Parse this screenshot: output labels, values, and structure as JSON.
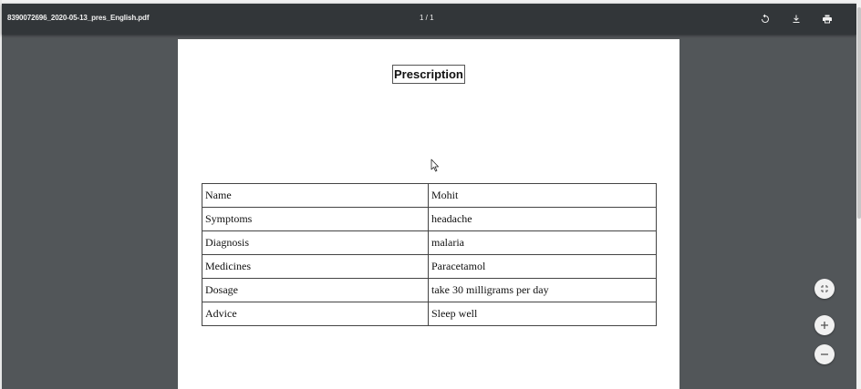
{
  "toolbar": {
    "document_title": "8390072696_2020-05-13_pres_English.pdf",
    "page_indicator": "1 / 1",
    "rotate_icon": "rotate-icon",
    "download_icon": "download-icon",
    "print_icon": "print-icon"
  },
  "page": {
    "heading": "Prescription",
    "rows": [
      {
        "key": "Name",
        "value": "Mohit"
      },
      {
        "key": "Symptoms",
        "value": "headache"
      },
      {
        "key": "Diagnosis",
        "value": "malaria"
      },
      {
        "key": "Medicines",
        "value": "Paracetamol"
      },
      {
        "key": "Dosage",
        "value": "take 30 milligrams per day"
      },
      {
        "key": "Advice",
        "value": "Sleep well"
      }
    ]
  },
  "zoom_controls": {
    "fit_icon": "fit-to-page-icon",
    "zoom_in_icon": "plus-icon",
    "zoom_out_icon": "minus-icon"
  },
  "colors": {
    "toolbar_bg": "#323639",
    "viewer_bg": "#525659",
    "page_bg": "#ffffff"
  }
}
